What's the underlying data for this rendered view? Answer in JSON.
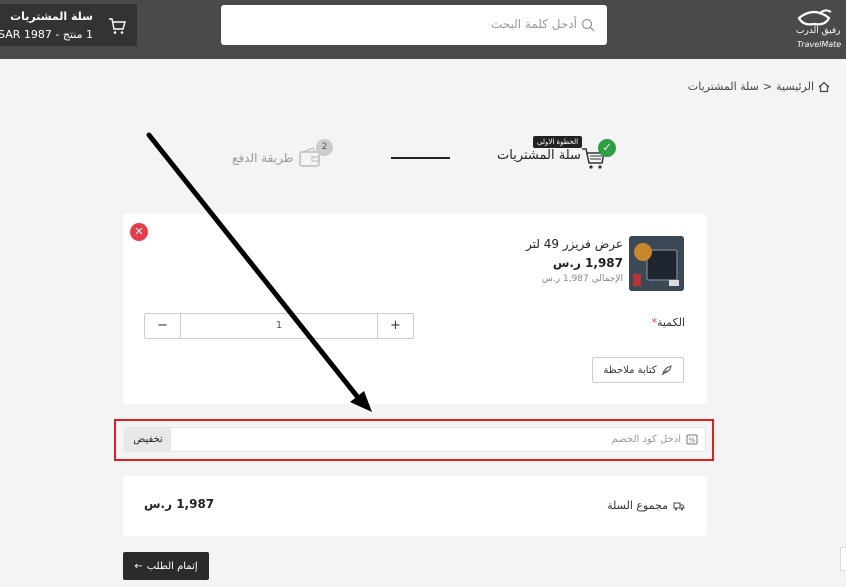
{
  "header": {
    "cart_title": "سلة المشتريات",
    "cart_summary": "1 منتج - SAR 1987",
    "search_placeholder": "أدخل كلمة البحث",
    "logo_ar": "رفيق الدرب",
    "logo_en": "TravelMate"
  },
  "breadcrumb": {
    "home": "الرئيسية",
    "separator": ">",
    "current": "سلة المشتريات"
  },
  "steps": {
    "step1_badge": "الخطوة الاولى",
    "step1_label": "سلة المشتريات",
    "step2_number": "2",
    "step2_label": "طريقة الدفع",
    "step1_check": "✓"
  },
  "product": {
    "name": "عرض فريزر 49 لتر",
    "price": "1,987 ر.س",
    "total": "الإجمالي 1,987 ر.س",
    "remove_glyph": "✕"
  },
  "quantity": {
    "label": "الكمية",
    "required_mark": "*",
    "value": "1",
    "minus": "−",
    "plus": "+"
  },
  "note": {
    "label": "كتابة ملاحظة"
  },
  "coupon": {
    "placeholder": "ادخل كود الخصم",
    "button": "تخفيض"
  },
  "totals": {
    "label": "مجموع السلة",
    "value": "1,987 ر.س"
  },
  "checkout": {
    "label": "إتمام الطلب",
    "arrow": "←"
  },
  "colors": {
    "header_bg": "#4a4a4a",
    "success": "#2e9e45",
    "danger": "#e53b4a",
    "highlight": "#e02020"
  }
}
